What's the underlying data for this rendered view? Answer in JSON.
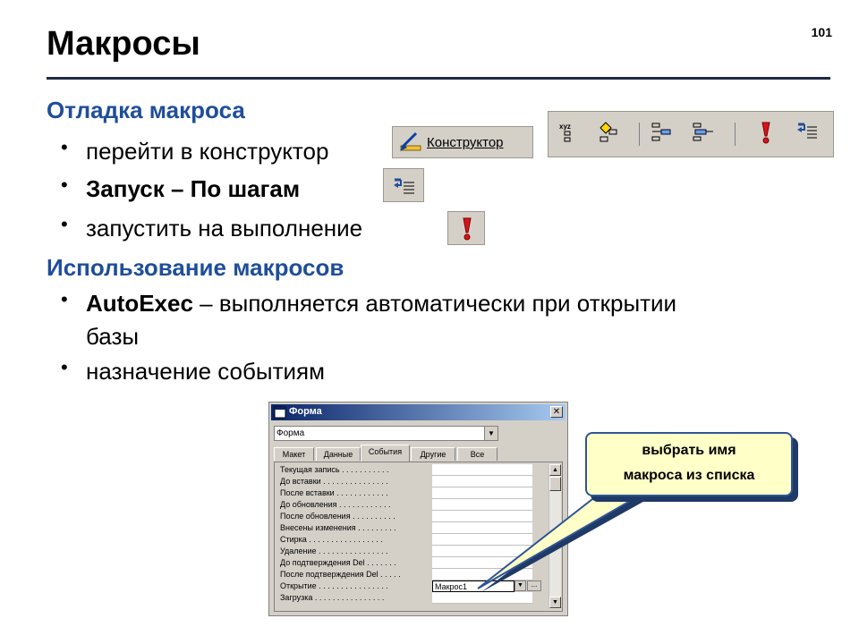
{
  "page_number": "101",
  "title": "Макросы",
  "sections": [
    {
      "heading": "Отладка макроса",
      "bullets": [
        {
          "text": "перейти в конструктор"
        },
        {
          "bold": "Запуск – По шагам"
        },
        {
          "text": "запустить  на выполнение"
        }
      ]
    },
    {
      "heading": "Использование макросов",
      "bullets": [
        {
          "bold": "AutoExec",
          "text": " – выполняется автоматически при открытии",
          "text2": "базы"
        },
        {
          "text": "назначение событиям"
        }
      ]
    }
  ],
  "toolbar": {
    "designer_label": "Конструктор"
  },
  "icons": [
    "designer-icon",
    "macro-names-icon",
    "conditions-icon",
    "insert-row-icon",
    "delete-row-icon",
    "run-icon",
    "single-step-icon"
  ],
  "dialog": {
    "title": "Форма",
    "object_combo_value": "Форма",
    "tabs": [
      "Макет",
      "Данные",
      "События",
      "Другие",
      "Все"
    ],
    "active_tab": "События",
    "properties": [
      {
        "label": "Текущая запись . . . . . . . . . . .",
        "value": ""
      },
      {
        "label": "До вставки . . . . . . . . . . . . . . .",
        "value": ""
      },
      {
        "label": "После вставки . . . . . . . . . . . .",
        "value": ""
      },
      {
        "label": "До обновления . . . . . . . . . . . .",
        "value": ""
      },
      {
        "label": "После обновления . . . . . . . . . .",
        "value": ""
      },
      {
        "label": "Внесены изменения . . . . . . . . .",
        "value": ""
      },
      {
        "label": "Стирка . . . . . . . . . . . . . . . . .",
        "value": ""
      },
      {
        "label": "Удаление . . . . . . . . . . . . . . . .",
        "value": ""
      },
      {
        "label": "До подтверждения Del . . . . . . .",
        "value": ""
      },
      {
        "label": "После подтверждения Del . . . . .",
        "value": ""
      },
      {
        "label": "Открытие . . . . . . . . . . . . . . . .",
        "value": "Макрос1"
      },
      {
        "label": "Загрузка . . . . . . . . . . . . . . . .",
        "value": ""
      }
    ]
  },
  "callout": {
    "line1": "выбрать имя",
    "line2": "макроса из списка"
  },
  "colors": {
    "heading": "#1f4e9a",
    "callout_fill": "#ffffc8",
    "callout_border": "#2f5496",
    "run_icon": "#d9141b"
  }
}
